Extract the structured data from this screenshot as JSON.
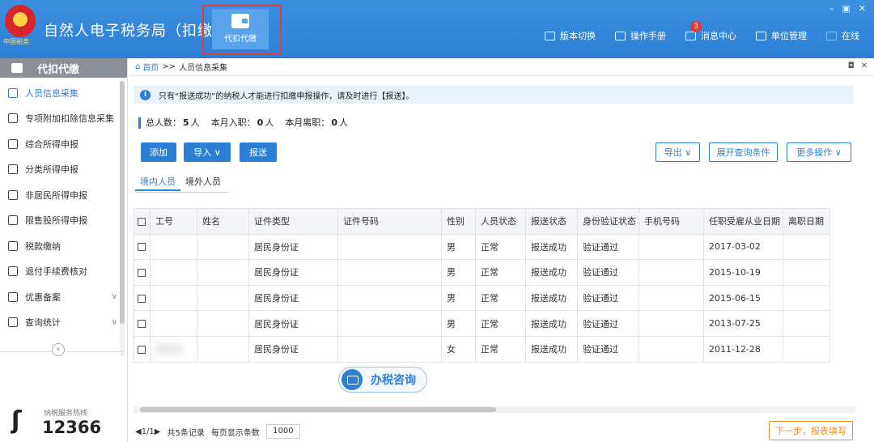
{
  "header": {
    "emblem_text": "中国税务",
    "app_title": "自然人电子税务局（扣缴端）",
    "module_label": "代扣代缴",
    "links": [
      {
        "label": "版本切换",
        "icon": "version-icon"
      },
      {
        "label": "操作手册",
        "icon": "manual-icon"
      },
      {
        "label": "消息中心",
        "icon": "message-icon",
        "badge": "3"
      },
      {
        "label": "单位管理",
        "icon": "org-icon"
      },
      {
        "label": "在线",
        "icon": "online-icon"
      }
    ],
    "window_controls": [
      "–",
      "▣",
      "✕"
    ]
  },
  "sidebar": {
    "title": "代扣代缴",
    "items": [
      {
        "label": "人员信息采集",
        "active": true
      },
      {
        "label": "专项附加扣除信息采集"
      },
      {
        "label": "综合所得申报"
      },
      {
        "label": "分类所得申报"
      },
      {
        "label": "非居民所得申报"
      },
      {
        "label": "限售股所得申报"
      },
      {
        "label": "税款缴纳"
      },
      {
        "label": "退付手续费核对"
      },
      {
        "label": "优惠备案",
        "chevron": "∨"
      },
      {
        "label": "查询统计",
        "chevron": "∨"
      }
    ],
    "collapse": "«",
    "hotline_label": "纳税服务热线",
    "hotline_number": "12366"
  },
  "content": {
    "breadcrumb_home": "首页",
    "breadcrumb_sep": ">>",
    "breadcrumb_current": "人员信息采集",
    "tab_controls": [
      "◘",
      "✕"
    ],
    "notice": "只有“报送成功”的纳税人才能进行扣缴申报操作，请及时进行【报送】。",
    "stats": {
      "total_label": "总人数：",
      "total": "5",
      "unit1": "人",
      "hired_label": "本月入职：",
      "hired": "0",
      "unit2": "人",
      "left_label": "本月离职：",
      "left": "0",
      "unit3": "人"
    },
    "buttons": {
      "add": "添加",
      "import": "导入 ∨",
      "submit": "报送",
      "export": "导出 ∨",
      "expand_query": "展开查询条件",
      "more": "更多操作 ∨"
    },
    "tabs": [
      "境内人员",
      "境外人员"
    ],
    "table": {
      "headers": [
        "",
        "工号",
        "姓名",
        "证件类型",
        "证件号码",
        "性别",
        "人员状态",
        "报送状态",
        "身份验证状态",
        "手机号码",
        "任职受雇从业日期",
        "离职日期"
      ],
      "rows": [
        {
          "id": "",
          "name": "",
          "idtype": "居民身份证",
          "idno": "",
          "sex": "男",
          "status": "正常",
          "submit": "报送成功",
          "verify": "验证通过",
          "phone": "",
          "hire": "2017-03-02",
          "leave": ""
        },
        {
          "id": "",
          "name": "",
          "idtype": "居民身份证",
          "idno": "",
          "sex": "男",
          "status": "正常",
          "submit": "报送成功",
          "verify": "验证通过",
          "phone": "",
          "hire": "2015-10-19",
          "leave": ""
        },
        {
          "id": "",
          "name": "",
          "idtype": "居民身份证",
          "idno": "",
          "sex": "男",
          "status": "正常",
          "submit": "报送成功",
          "verify": "验证通过",
          "phone": "",
          "hire": "2015-06-15",
          "leave": ""
        },
        {
          "id": "",
          "name": "",
          "idtype": "居民身份证",
          "idno": "",
          "sex": "男",
          "status": "正常",
          "submit": "报送成功",
          "verify": "验证通过",
          "phone": "",
          "hire": "2013-07-25",
          "leave": ""
        },
        {
          "id": "F0031",
          "name": "",
          "idtype": "居民身份证",
          "idno": "",
          "sex": "女",
          "status": "正常",
          "submit": "报送成功",
          "verify": "验证通过",
          "phone": "",
          "hire": "2011-12-28",
          "leave": ""
        }
      ]
    },
    "consult_label": "办税咨询",
    "pagination": {
      "pager": "◀1/1▶",
      "total": "共5条记录",
      "per_page_label": "每页显示条数",
      "per_page": "1000"
    },
    "next_button": "下一步，报表填写"
  }
}
